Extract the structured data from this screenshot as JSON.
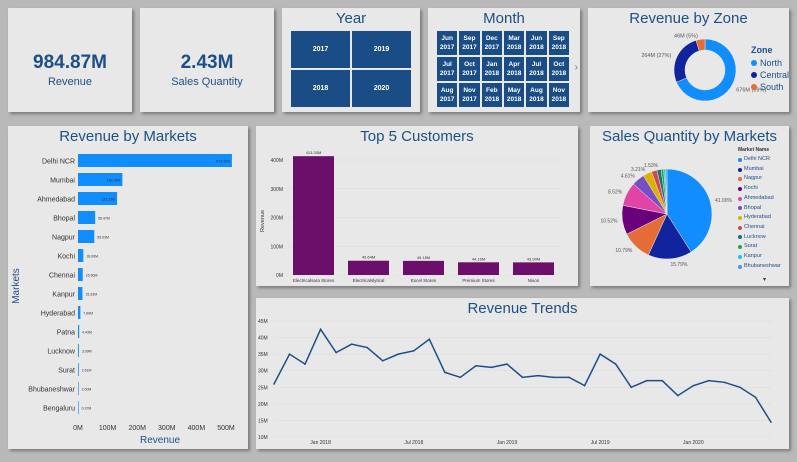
{
  "kpis": {
    "revenue": {
      "value": "984.87M",
      "label": "Revenue"
    },
    "quantity": {
      "value": "2.43M",
      "label": "Sales Quantity"
    }
  },
  "year_slicer": {
    "title": "Year",
    "options": [
      "2017",
      "2019",
      "2018",
      "2020"
    ]
  },
  "month_slicer": {
    "title": "Month",
    "options": [
      "Jun\n2017",
      "Sep\n2017",
      "Dec\n2017",
      "Mar\n2018",
      "Jun\n2018",
      "Sep\n2018",
      "Jul\n2017",
      "Oct\n2017",
      "Jan\n2018",
      "Apr\n2018",
      "Jul\n2018",
      "Oct\n2018",
      "Aug\n2017",
      "Nov\n2017",
      "Feb\n2018",
      "May\n2018",
      "Aug\n2018",
      "Nov\n2018"
    ],
    "scroll_arrow": "›"
  },
  "zone_chart": {
    "title": "Revenue by Zone",
    "legend_title": "Zone",
    "colors": [
      "#118dff",
      "#12239e",
      "#e66c37"
    ],
    "chart_data": {
      "type": "pie",
      "categories": [
        "North",
        "Central",
        "South"
      ],
      "values": [
        676,
        264,
        46
      ],
      "data_labels": [
        "676M (69%)",
        "264M (27%)",
        "46M (5%)"
      ]
    }
  },
  "markets_chart": {
    "title": "Revenue by Markets",
    "color": "#118dff",
    "chart_data": {
      "type": "bar",
      "orientation": "horizontal",
      "categories": [
        "Delhi NCR",
        "Mumbai",
        "Ahmedabad",
        "Bhopal",
        "Nagpur",
        "Kochi",
        "Chennai",
        "Kanpur",
        "Hyderabad",
        "Patna",
        "Lucknow",
        "Surat",
        "Bhubaneshwar",
        "Bengaluru"
      ],
      "values": [
        520,
        150,
        132,
        58,
        55,
        18,
        16,
        15,
        8,
        4,
        3,
        2.5,
        2,
        0.4
      ],
      "data_labels": [
        "519.99M",
        "150.08M",
        "132.33M",
        "58.47M",
        "55.03M",
        "18.00M",
        "15.60M",
        "15.33M",
        "7.66M",
        "4.43M",
        "3.09M",
        "2.61M",
        "2.00M",
        "0.37M"
      ],
      "xlabel": "Revenue",
      "ylabel": "Markets",
      "xticks": [
        "0M",
        "100M",
        "200M",
        "300M",
        "400M",
        "500M"
      ],
      "xlim": [
        0,
        500
      ]
    }
  },
  "customers_chart": {
    "title": "Top 5 Customers",
    "color": "#6b0f6b",
    "chart_data": {
      "type": "bar",
      "categories": [
        "Electricalsara Stores",
        "Electricalslytical",
        "Excel Stores",
        "Premium Stores",
        "Nixon"
      ],
      "values": [
        413.33,
        49.64,
        49.18,
        44.16,
        43.9
      ],
      "data_labels": [
        "413.33M",
        "49.64M",
        "49.18M",
        "44.16M",
        "43.90M"
      ],
      "ylabel": "Revenue",
      "yticks": [
        "0M",
        "100M",
        "200M",
        "300M",
        "400M"
      ],
      "ylim": [
        0,
        400
      ]
    }
  },
  "qty_chart": {
    "title": "Sales Quantity by Markets",
    "legend_title": "Market Name",
    "colors": [
      "#118dff",
      "#12239e",
      "#e66c37",
      "#6b007b",
      "#e044a7",
      "#744ec2",
      "#d9b300",
      "#d64550",
      "#197278",
      "#1aab40",
      "#15c6f4",
      "#4092ff"
    ],
    "chart_data": {
      "type": "pie",
      "categories": [
        "Delhi NCR",
        "Mumbai",
        "Nagpur",
        "Kochi",
        "Ahmedabad",
        "Bhopal",
        "Hyderabad",
        "Chennai",
        "Lucknow",
        "Surat",
        "Kanpur",
        "Bhubaneshwar"
      ],
      "values": [
        41,
        15.8,
        10.8,
        10.5,
        8.5,
        4.6,
        3.2,
        2.0,
        1.5,
        0.9,
        0.7,
        0.5
      ],
      "data_labels": [
        "41.00%",
        "15.79%",
        "10.79%",
        "10.52%",
        "8.52%",
        "4.61%",
        "3.21%",
        "",
        "1.53%",
        "",
        "",
        ""
      ]
    },
    "more_indicator": "▾"
  },
  "trend_chart": {
    "title": "Revenue Trends",
    "color": "#1b4f8a",
    "chart_data": {
      "type": "line",
      "x": [
        "2017-10",
        "2017-11",
        "2017-12",
        "2018-01",
        "2018-02",
        "2018-03",
        "2018-04",
        "2018-05",
        "2018-06",
        "2018-07",
        "2018-08",
        "2018-09",
        "2018-10",
        "2018-11",
        "2018-12",
        "2019-01",
        "2019-02",
        "2019-03",
        "2019-04",
        "2019-05",
        "2019-06",
        "2019-07",
        "2019-08",
        "2019-09",
        "2019-10",
        "2019-11",
        "2019-12",
        "2020-01",
        "2020-02",
        "2020-03",
        "2020-04",
        "2020-05",
        "2020-06"
      ],
      "values": [
        26,
        35,
        32,
        42.5,
        35.5,
        38,
        37,
        33,
        35,
        36,
        39.5,
        29.5,
        28,
        31.5,
        31,
        32,
        28,
        28.5,
        28,
        28,
        25.5,
        35,
        32,
        25,
        27,
        27,
        22.5,
        25.5,
        27,
        26.5,
        25,
        22,
        14.5
      ],
      "xticks": [
        "Jan 2018",
        "Jul 2018",
        "Jan 2019",
        "Jul 2019",
        "Jan 2020"
      ],
      "yticks": [
        "10M",
        "15M",
        "20M",
        "25M",
        "30M",
        "35M",
        "40M",
        "45M"
      ],
      "ylim": [
        10,
        45
      ]
    }
  }
}
